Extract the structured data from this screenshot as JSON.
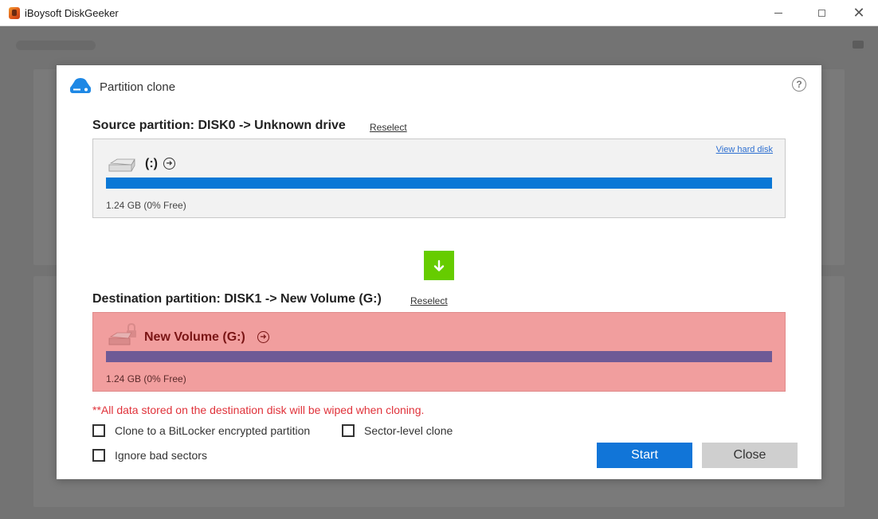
{
  "window": {
    "title": "iBoysoft DiskGeeker",
    "controls": {
      "close": "✕"
    }
  },
  "dialog": {
    "title": "Partition clone",
    "help": "?",
    "source": {
      "heading": "Source partition: DISK0 -> Unknown drive",
      "reselect": "Reselect",
      "view_hard_disk": "View hard disk",
      "volume_label": "(:)",
      "size_info": "1.24 GB (0% Free)",
      "bar_color": "#0a78d6"
    },
    "destination": {
      "heading": "Destination partition: DISK1 -> New Volume (G:)",
      "reselect": "Reselect",
      "volume_label": "New Volume (G:)",
      "size_info": "1.24 GB (0% Free)",
      "bar_color": "#6e5a96",
      "box_color": "#f19e9e"
    },
    "warning": "**All data stored on the destination disk will be wiped when cloning.",
    "options": {
      "bitlocker": "Clone to a BitLocker encrypted partition",
      "sector_level": "Sector-level clone",
      "ignore_bad": "Ignore bad sectors"
    },
    "buttons": {
      "start": "Start",
      "close": "Close"
    },
    "colors": {
      "accent": "#1175d8",
      "warning": "#e0323a",
      "arrow": "#66cc00"
    }
  }
}
